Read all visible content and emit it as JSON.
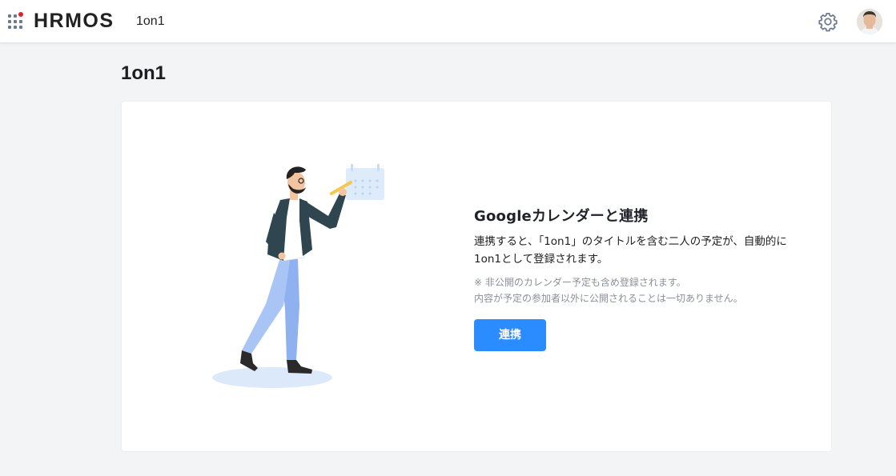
{
  "header": {
    "logo_text": "HRMOS",
    "product_name": "1on1",
    "apps_icon": "apps-grid-icon",
    "settings_icon": "gear-icon",
    "avatar_icon": "user-avatar"
  },
  "page": {
    "title": "1on1"
  },
  "card": {
    "title": "Googleカレンダーと連携",
    "description": "連携すると、「1on1」のタイトルを含む二人の予定が、自動的に1on1として登録されます。",
    "note_line1": "※ 非公開のカレンダー予定も含め登録されます。",
    "note_line2": "内容が予定の参加者以外に公開されることは一切ありません。",
    "button_label": "連携"
  },
  "colors": {
    "accent": "#2b8cff",
    "brand_dot": "#e0202d",
    "background": "#f3f4f6"
  }
}
